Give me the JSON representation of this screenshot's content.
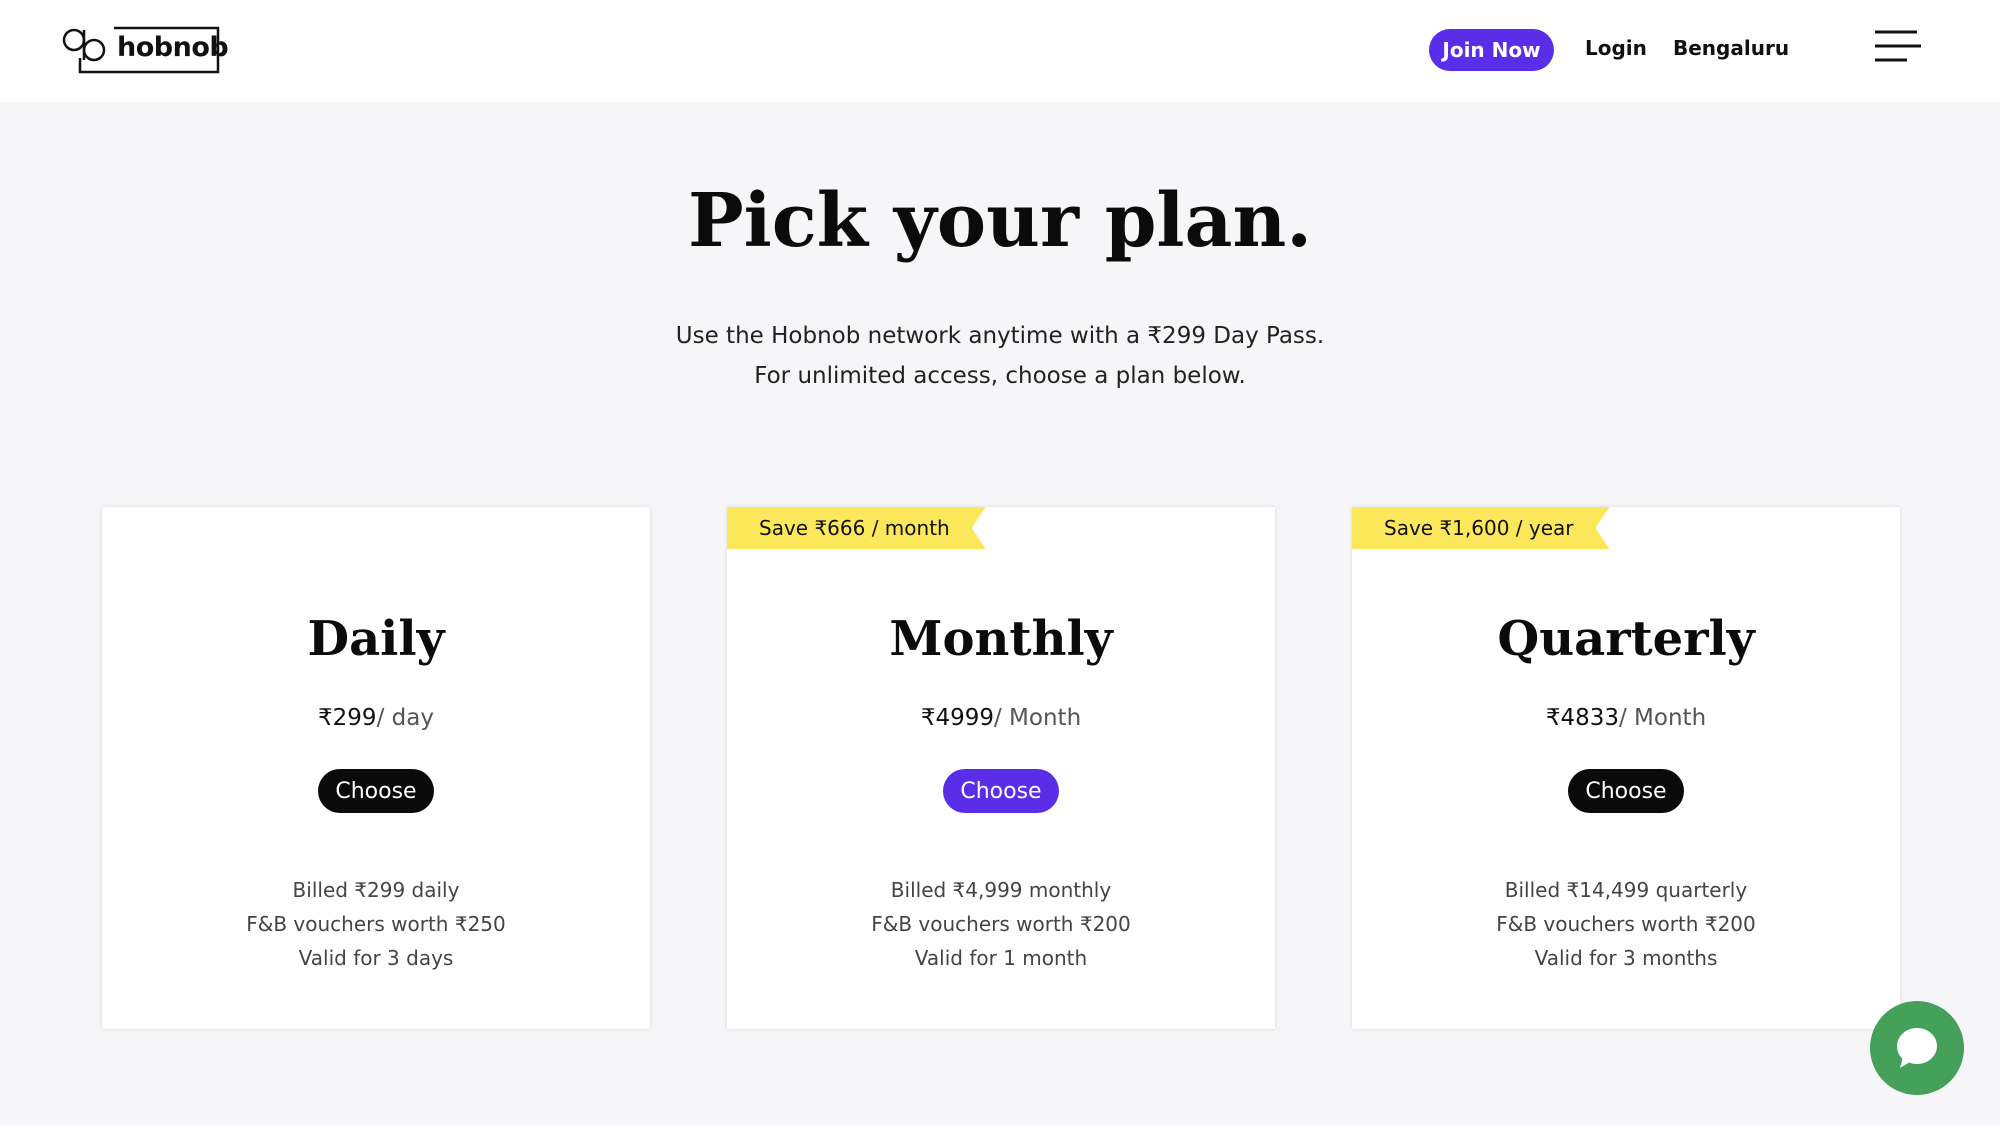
{
  "header": {
    "logo_text": "hobnob",
    "join_label": "Join Now",
    "login_label": "Login",
    "city_label": "Bengaluru"
  },
  "hero": {
    "title": "Pick your plan.",
    "subtitle_line1": "Use the Hobnob network anytime with a ₹299 Day Pass.",
    "subtitle_line2": "For unlimited access, choose a plan below."
  },
  "plans": [
    {
      "ribbon": "",
      "name": "Daily",
      "price": "₹299",
      "unit": "/ day",
      "button_label": "Choose",
      "button_color": "#0a0a0a",
      "features": [
        "Billed ₹299 daily",
        "F&B vouchers worth ₹250",
        "Valid for 3 days"
      ]
    },
    {
      "ribbon": "Save ₹666 / month",
      "name": "Monthly",
      "price": "₹4999",
      "unit": "/ Month",
      "button_label": "Choose",
      "button_color": "#5a2ee8",
      "features": [
        "Billed ₹4,999 monthly",
        "F&B vouchers worth ₹200",
        "Valid for 1 month"
      ]
    },
    {
      "ribbon": "Save ₹1,600 / year",
      "name": "Quarterly",
      "price": "₹4833",
      "unit": "/ Month",
      "button_label": "Choose",
      "button_color": "#0a0a0a",
      "features": [
        "Billed ₹14,499 quarterly",
        "F&B vouchers worth ₹200",
        "Valid for 3 months"
      ]
    }
  ],
  "icons": {
    "menu": "hamburger-icon",
    "chat": "chat-bubble-icon",
    "logo": "hobnob-logo-icon"
  },
  "colors": {
    "accent": "#5a2ee8",
    "ribbon": "#fbe85a",
    "chat": "#45a15a",
    "background": "#f6f6f8"
  }
}
